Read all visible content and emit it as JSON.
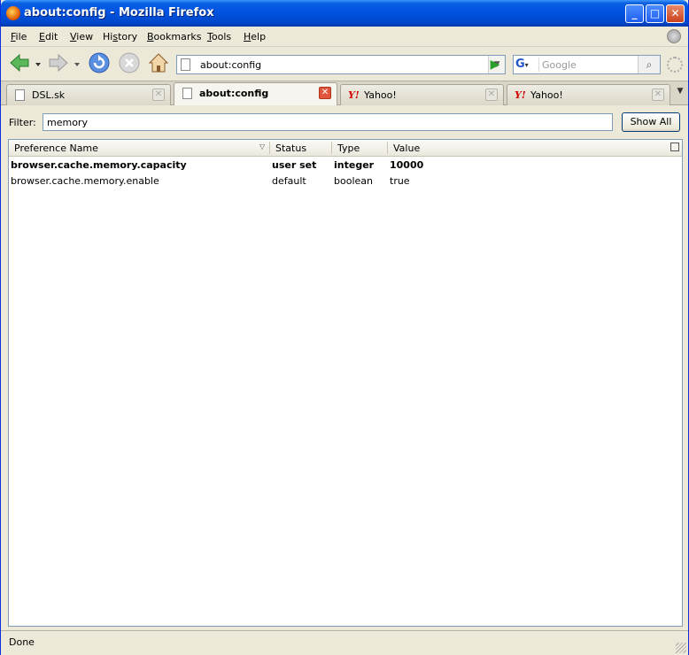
{
  "window": {
    "title": "about:config - Mozilla Firefox"
  },
  "menu": {
    "items": [
      {
        "label": "File",
        "accel": "F",
        "rest": "ile"
      },
      {
        "label": "Edit",
        "accel": "E",
        "rest": "dit"
      },
      {
        "label": "View",
        "accel": "V",
        "rest": "iew"
      },
      {
        "label": "History",
        "accel": "",
        "pre": "Hi",
        "u": "s",
        "post": "tory"
      },
      {
        "label": "Bookmarks",
        "accel": "B",
        "rest": "ookmarks"
      },
      {
        "label": "Tools",
        "accel": "T",
        "rest": "ools"
      },
      {
        "label": "Help",
        "accel": "H",
        "rest": "elp"
      }
    ]
  },
  "toolbar": {
    "url": "about:config",
    "search_placeholder": "Google",
    "search_engine": "G"
  },
  "tabs": [
    {
      "label": "DSL.sk",
      "icon": "page-icon",
      "active": false
    },
    {
      "label": "about:config",
      "icon": "page-icon",
      "active": true
    },
    {
      "label": "Yahoo!",
      "icon": "yahoo-icon",
      "active": false
    },
    {
      "label": "Yahoo!",
      "icon": "yahoo-icon",
      "active": false
    }
  ],
  "filter": {
    "label": "Filter:",
    "value": "memory",
    "show_all": "Show All"
  },
  "table": {
    "columns": [
      "Preference Name",
      "Status",
      "Type",
      "Value"
    ],
    "rows": [
      {
        "name": "browser.cache.memory.capacity",
        "status": "user set",
        "type": "integer",
        "value": "10000",
        "bold": true
      },
      {
        "name": "browser.cache.memory.enable",
        "status": "default",
        "type": "boolean",
        "value": "true",
        "bold": false
      }
    ]
  },
  "status": {
    "text": "Done"
  },
  "colors": {
    "titlebar": "#0054e3",
    "chrome": "#ece9d8",
    "close_active": "#e0553b"
  }
}
